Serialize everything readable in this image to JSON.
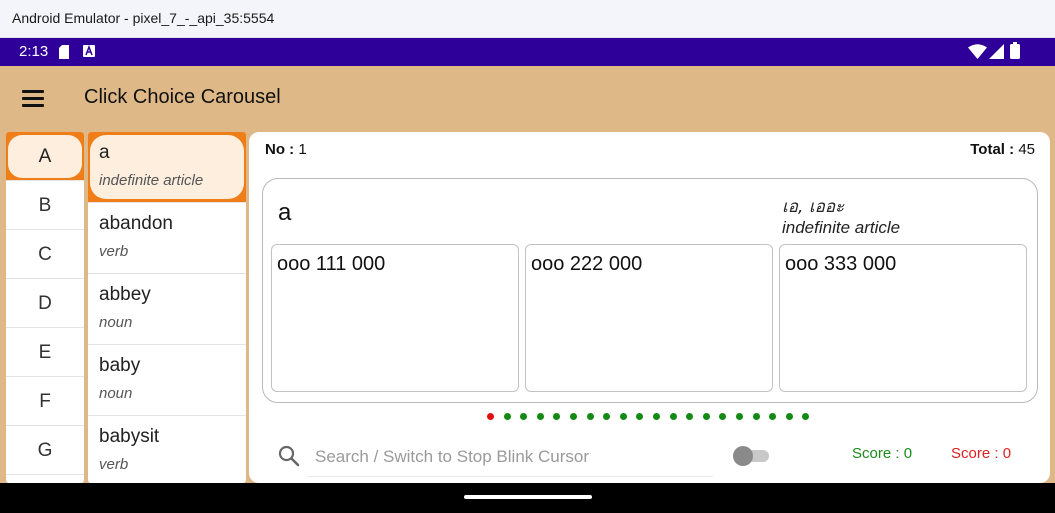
{
  "window": {
    "title": "Android Emulator - pixel_7_-_api_35:5554"
  },
  "status_bar": {
    "time": "2:13"
  },
  "app_bar": {
    "title": "Click Choice Carousel"
  },
  "letters": [
    "A",
    "B",
    "C",
    "D",
    "E",
    "F",
    "G"
  ],
  "selected_letter": "A",
  "words": [
    {
      "word": "a",
      "pos": "indefinite article",
      "selected": true
    },
    {
      "word": "abandon",
      "pos": "verb"
    },
    {
      "word": "abbey",
      "pos": "noun"
    },
    {
      "word": "baby",
      "pos": "noun"
    },
    {
      "word": "babysit",
      "pos": "verb"
    }
  ],
  "main": {
    "no_label": "No :",
    "no_value": "1",
    "total_label": "Total :",
    "total_value": "45",
    "card": {
      "word": "a",
      "translation": "เอ, เออะ",
      "pos": "indefinite article",
      "choices": [
        "ooo 111 000",
        "ooo 222 000",
        "ooo 333 000"
      ]
    },
    "progress": {
      "total": 20,
      "current": 1,
      "current_color": "#e01010",
      "other_color": "#138a13"
    },
    "search": {
      "placeholder": "Search / Switch to Stop Blink Cursor"
    },
    "toggle_on": false,
    "score_correct_label": "Score :",
    "score_correct": "0",
    "score_wrong_label": "Score :",
    "score_wrong": "0"
  },
  "colors": {
    "app_bar": "#deb887",
    "status_bar": "#2e0099",
    "selected": "#ef7d18"
  }
}
